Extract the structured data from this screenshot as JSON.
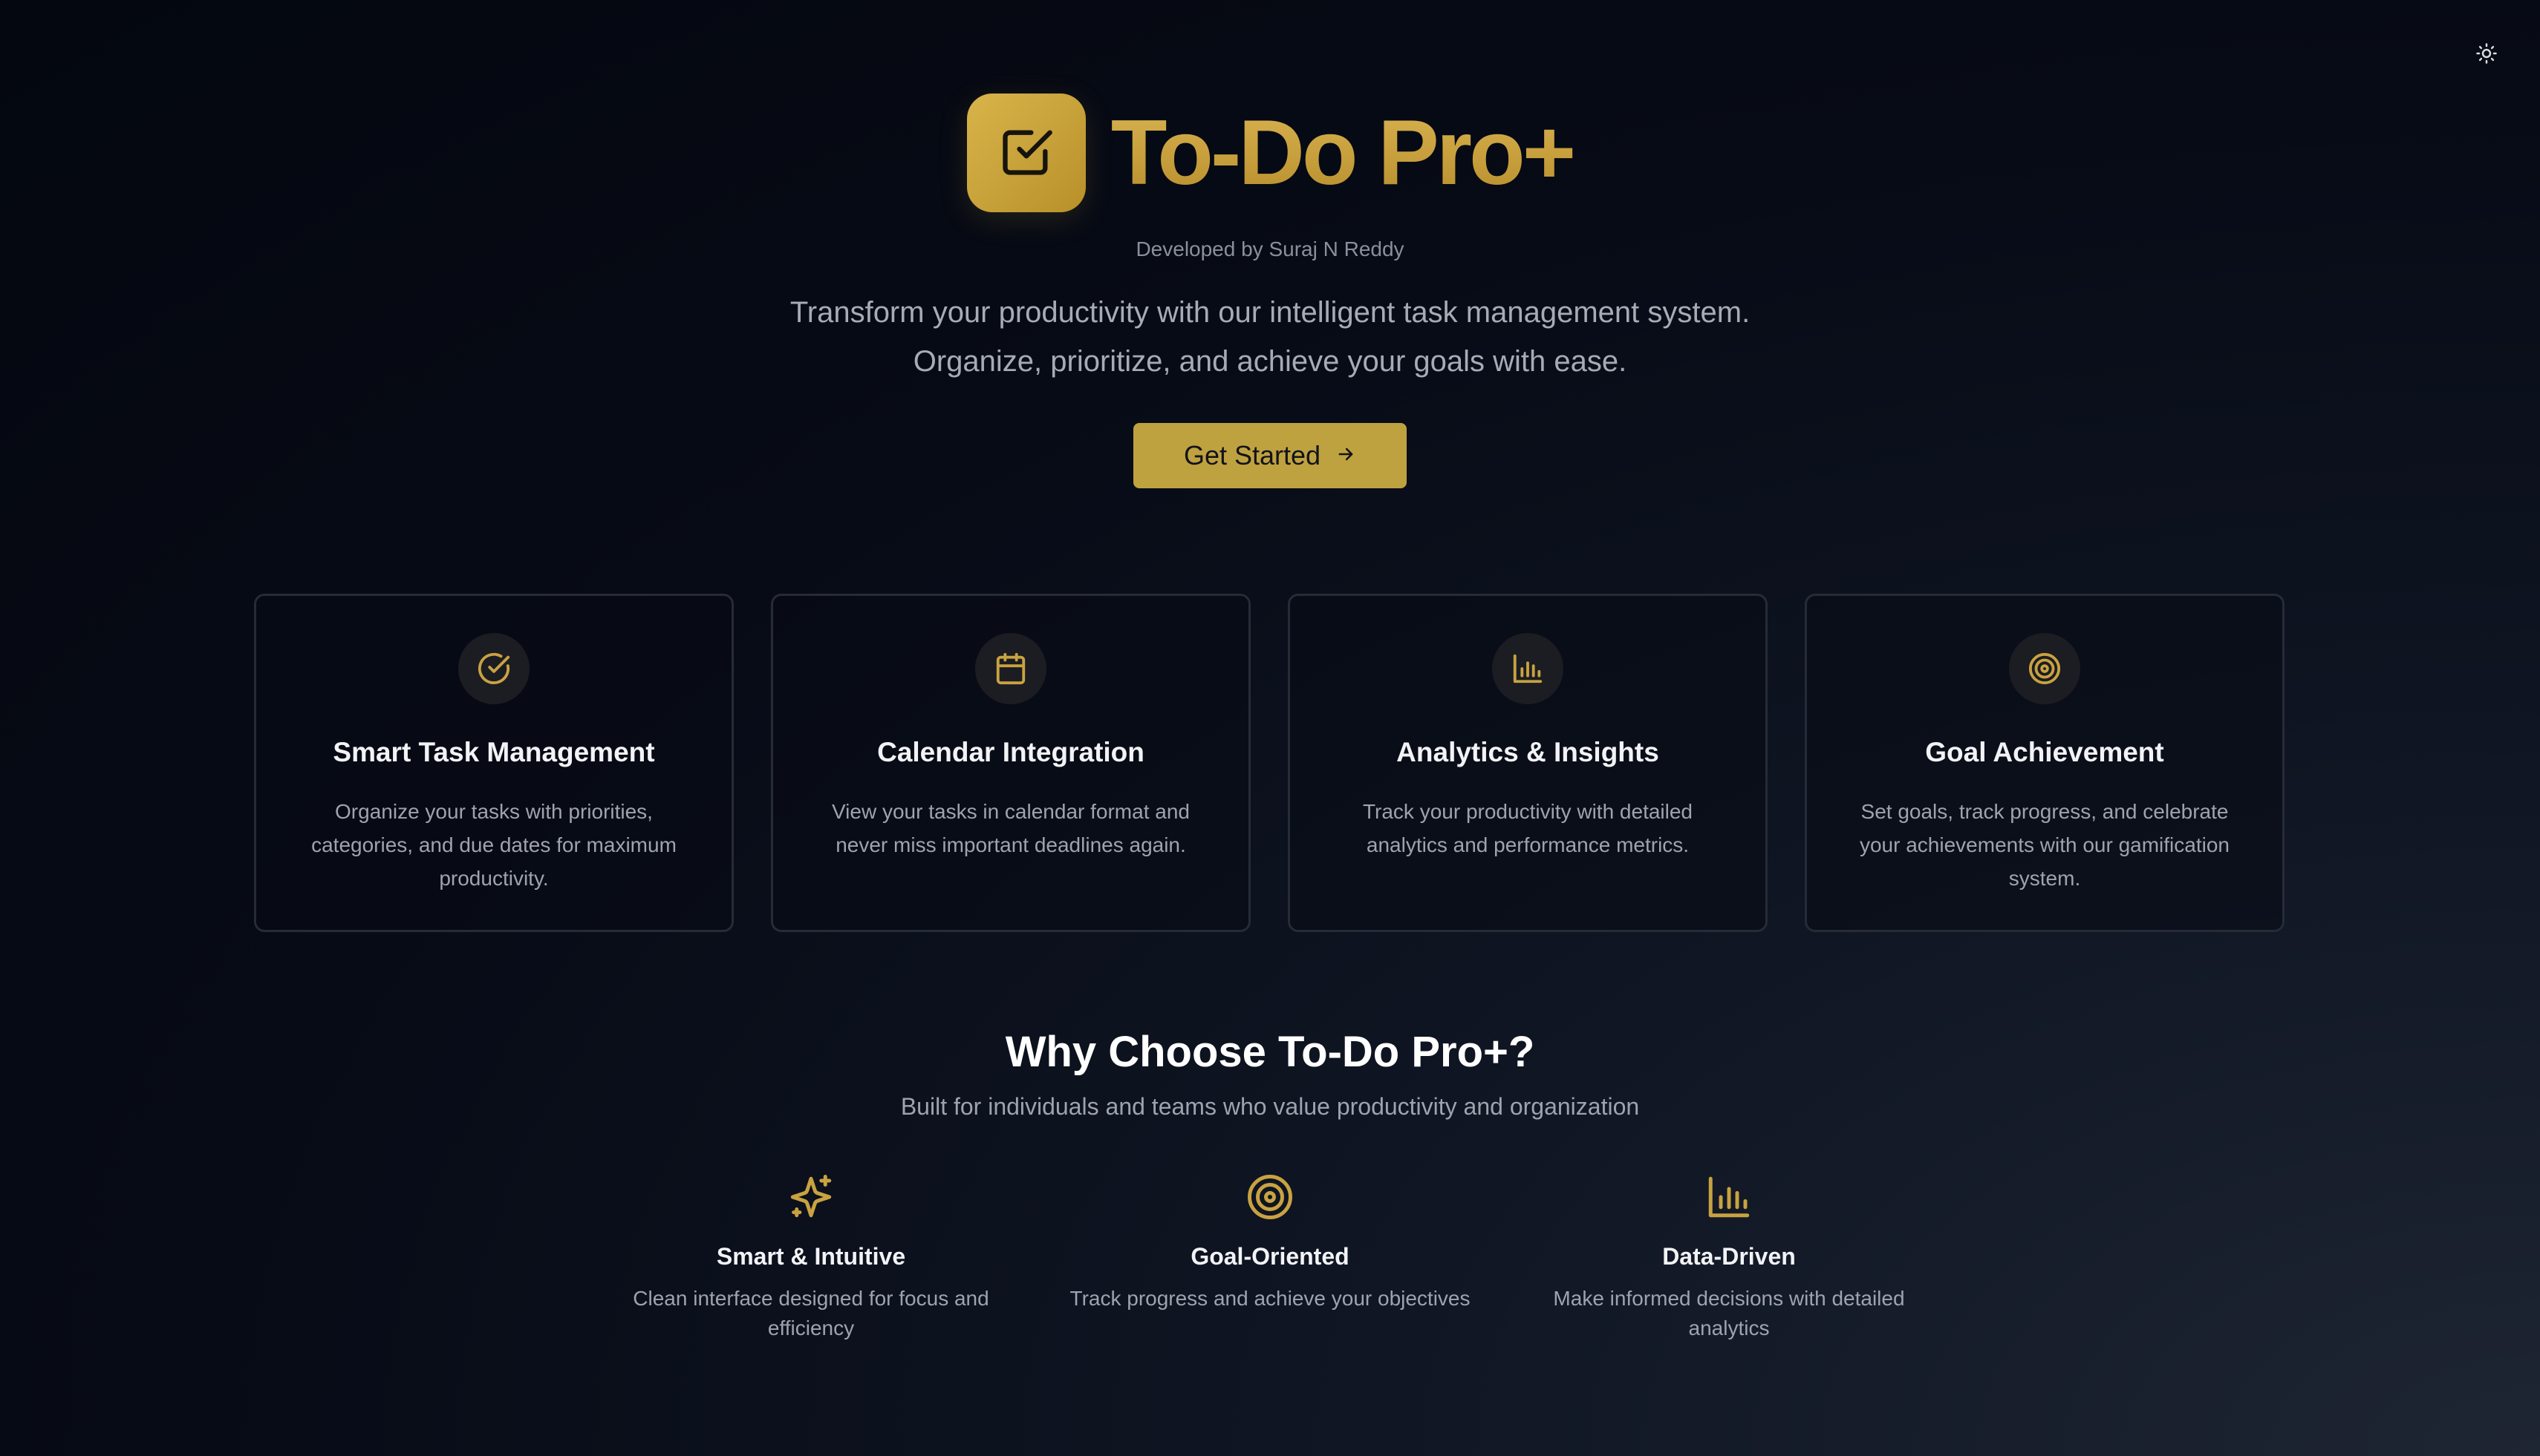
{
  "header": {
    "theme_toggle_icon": "sun-icon"
  },
  "hero": {
    "logo_icon": "checkbox-icon",
    "title": "To-Do Pro+",
    "developer": "Developed by Suraj N Reddy",
    "tagline_line1": "Transform your productivity with our intelligent task management system.",
    "tagline_line2": "Organize, prioritize, and achieve your goals with ease.",
    "cta_label": "Get Started",
    "cta_icon": "arrow-right-icon"
  },
  "features": [
    {
      "icon": "check-circle-icon",
      "title": "Smart Task Management",
      "description": "Organize your tasks with priorities, categories, and due dates for maximum productivity."
    },
    {
      "icon": "calendar-icon",
      "title": "Calendar Integration",
      "description": "View your tasks in calendar format and never miss important deadlines again."
    },
    {
      "icon": "bar-chart-icon",
      "title": "Analytics & Insights",
      "description": "Track your productivity with detailed analytics and performance metrics."
    },
    {
      "icon": "target-icon",
      "title": "Goal Achievement",
      "description": "Set goals, track progress, and celebrate your achievements with our gamification system."
    }
  ],
  "why": {
    "title": "Why Choose To-Do Pro+?",
    "subtitle": "Built for individuals and teams who value productivity and organization"
  },
  "benefits": [
    {
      "icon": "sparkles-icon",
      "title": "Smart & Intuitive",
      "description": "Clean interface designed for focus and efficiency"
    },
    {
      "icon": "target-icon",
      "title": "Goal-Oriented",
      "description": "Track progress and achieve your objectives"
    },
    {
      "icon": "bar-chart-icon",
      "title": "Data-Driven",
      "description": "Make informed decisions with detailed analytics"
    }
  ],
  "colors": {
    "accent": "#c9a241",
    "button": "#bfa240",
    "background": "#04070f",
    "card_border": "#262b37",
    "muted_text": "#9ea3ae"
  }
}
